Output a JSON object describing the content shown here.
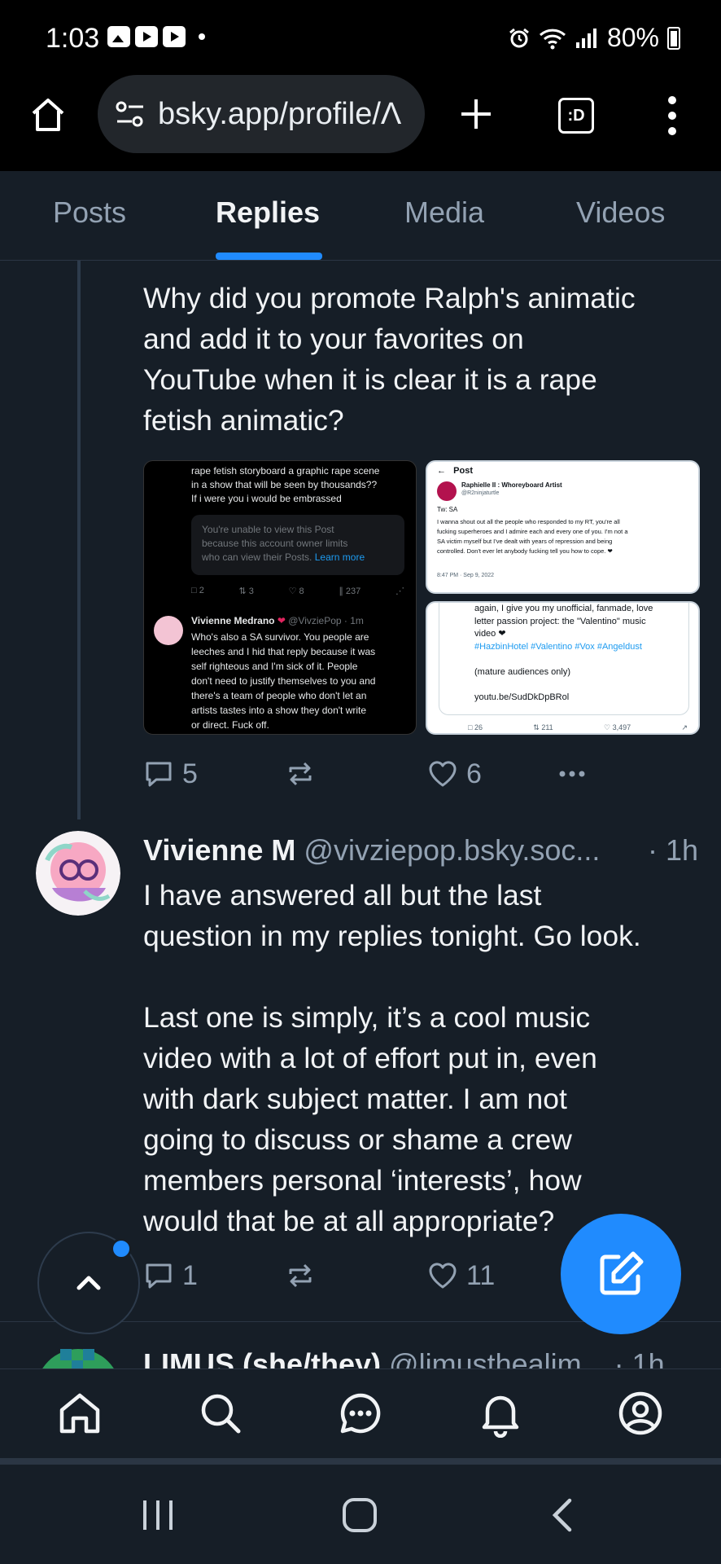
{
  "status_bar": {
    "time": "1:03",
    "battery": "80%"
  },
  "browser": {
    "url": "bsky.app/profile/Λ",
    "tabs_icon_label": ":D"
  },
  "profile_tabs": [
    "Posts",
    "Replies",
    "Media",
    "Videos"
  ],
  "active_tab": "Replies",
  "parent_post": {
    "text_lines": [
      "Why did you promote Ralph's animatic",
      "and add it to your favorites on",
      "YouTube when it is clear it is a rape",
      "fetish animatic?"
    ],
    "media": {
      "left": {
        "top_lines": [
          "rape fetish storyboard a graphic rape scene",
          "in a show that will be seen by thousands??",
          "If i were you i would be embrassed"
        ],
        "notice_lines": [
          "You're unable to view this Post",
          "because this account owner limits",
          "who can view their Posts."
        ],
        "notice_link": "Learn more",
        "stats": [
          "2",
          "3",
          "8",
          "237"
        ],
        "reply_name": "Vivienne Medrano",
        "reply_meta": "@VivziePop · 1m",
        "reply_lines": [
          "Who's also a SA survivor. You people are",
          "leeches and I hid that reply because it was",
          "self righteous and I'm sick of it. People",
          "don't need to justify themselves to you and",
          "there's a team of people who don't let an",
          "artists tastes into a show they don't write",
          "or direct. Fuck off."
        ]
      },
      "right_top": {
        "header": "Post",
        "name": "Raphielle II : Whoreyboard Artist",
        "handle": "@R2ninjaturtle",
        "tw": "Tw: SA",
        "body_lines": [
          "I wanna shout out all the people who responded to my RT, you're all",
          "fucking superheroes and I admire each and every one of you. I'm not a",
          "SA victim myself but I've dealt with years of repression and being",
          "controlled. Don't ever let anybody fucking tell you how to cope. ❤"
        ],
        "meta": "8:47 PM · Sep 9, 2022"
      },
      "right_bottom": {
        "lines": [
          "again, I give you my unofficial, fanmade, love",
          "letter passion project: the \"Valentino\" music",
          "video ❤",
          "#HazbinHotel #Valentino #Vox #Angeldust",
          "",
          "(mature audiences only)",
          "",
          "youtu.be/SudDkDpBRol"
        ],
        "stats": [
          "26",
          "211",
          "3,497"
        ]
      }
    },
    "replies": "5",
    "likes": "6"
  },
  "reply_post": {
    "author_name": "Vivienne M",
    "author_handle": "@vivziepop.bsky.soc...",
    "time": "· 1h",
    "text_lines": [
      "I have answered all but the last",
      "question in my replies tonight. Go look.",
      "",
      "Last one is simply, it’s a cool music",
      "video with a lot of effort put in, even",
      "with dark subject matter. I am not",
      "going to discuss or shame a crew",
      "members personal ‘interests’, how",
      "would that be at all appropriate?"
    ],
    "replies": "1",
    "likes": "11"
  },
  "next_post_peek": {
    "author_name": "LIMUS (she/they)",
    "author_handle": "@limusthealim...",
    "time": "· 1h"
  },
  "colors": {
    "background": "#161e27",
    "accent": "#208bfe",
    "muted_text": "#93a2b3",
    "border": "#2b3644"
  }
}
